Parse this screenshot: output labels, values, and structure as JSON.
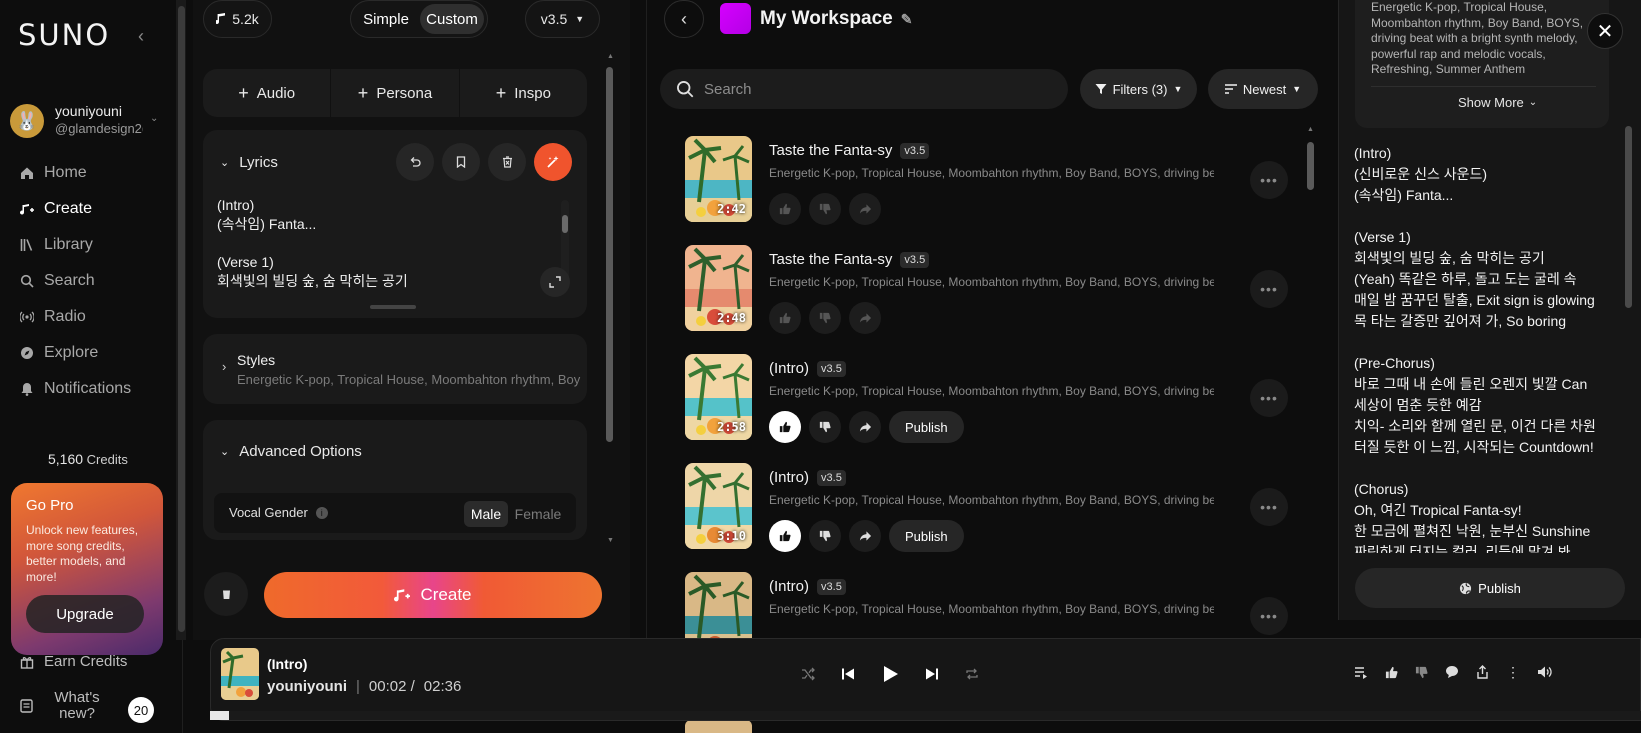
{
  "sidebar": {
    "logo": "SUNO",
    "user": {
      "name": "youniyouni",
      "handle": "@glamdesign2("
    },
    "nav": [
      {
        "label": "Home",
        "icon": "home-icon"
      },
      {
        "label": "Create",
        "icon": "create-icon"
      },
      {
        "label": "Library",
        "icon": "library-icon"
      },
      {
        "label": "Search",
        "icon": "search-icon"
      },
      {
        "label": "Radio",
        "icon": "radio-icon"
      },
      {
        "label": "Explore",
        "icon": "explore-icon"
      },
      {
        "label": "Notifications",
        "icon": "bell-icon"
      }
    ],
    "credits_value": "5,160",
    "credits_label": "Credits",
    "gopro": {
      "title": "Go Pro",
      "desc": "Unlock new features, more song credits, better models, and more!",
      "button": "Upgrade"
    },
    "earn": "Earn Credits",
    "whats_new": "What's new?",
    "whats_new_count": "20"
  },
  "create": {
    "count": "5.2k",
    "mode_simple": "Simple",
    "mode_custom": "Custom",
    "model": "v3.5",
    "add_audio": "Audio",
    "add_persona": "Persona",
    "add_inspo": "Inspo",
    "lyrics_label": "Lyrics",
    "lyrics_lines": [
      "(Intro)",
      "(속삭임) Fanta...",
      "",
      "(Verse 1)",
      "회색빛의 빌딩 숲, 숨 막히는 공기"
    ],
    "styles_label": "Styles",
    "styles_value": "Energetic K-pop, Tropical House, Moombahton rhythm, Boy ...",
    "advanced_label": "Advanced Options",
    "vocal_gender_label": "Vocal Gender",
    "vocal_male": "Male",
    "vocal_female": "Female",
    "create_button": "Create"
  },
  "workspace": {
    "title": "My Workspace",
    "search_placeholder": "Search",
    "filters": "Filters (3)",
    "sort": "Newest",
    "songs": [
      {
        "title": "Taste the Fanta-sy",
        "version": "v3.5",
        "desc": "Energetic K-pop, Tropical House, Moombahton rhythm, Boy Band, BOYS, driving beat ...",
        "duration": "2:42",
        "publish": ""
      },
      {
        "title": "Taste the Fanta-sy",
        "version": "v3.5",
        "desc": "Energetic K-pop, Tropical House, Moombahton rhythm, Boy Band, BOYS, driving beat ...",
        "duration": "2:48",
        "publish": ""
      },
      {
        "title": "(Intro)",
        "version": "v3.5",
        "desc": "Energetic K-pop, Tropical House, Moombahton rhythm, Boy Band, BOYS, driving beat ...",
        "duration": "2:58",
        "publish": "Publish"
      },
      {
        "title": "(Intro)",
        "version": "v3.5",
        "desc": "Energetic K-pop, Tropical House, Moombahton rhythm, Boy Band, BOYS, driving beat ...",
        "duration": "3:10",
        "publish": "Publish"
      },
      {
        "title": "(Intro)",
        "version": "v3.5",
        "desc": "Energetic K-pop, Tropical House, Moombahton rhythm, Boy Band, BOYS, driving beat ...",
        "duration": "",
        "publish": ""
      }
    ],
    "bottom_desc": "Energetic K-pop, Tropical House, Moombahton rhythm, Boy Band, BOYS, driving beat ..."
  },
  "detail": {
    "style_text": "Energetic K-pop, Tropical House, Moombahton rhythm, Boy Band, BOYS, driving beat with a bright synth melody, powerful rap and melodic vocals, Refreshing, Summer Anthem",
    "show_more": "Show More",
    "lyrics": "(Intro)\n(신비로운 신스 사운드)\n(속삭임) Fanta...\n\n(Verse 1)\n회색빛의 빌딩 숲, 숨 막히는 공기\n(Yeah) 똑같은 하루, 돌고 도는 굴레 속\n매일 밤 꿈꾸던 탈출, Exit sign is glowing\n목 타는 갈증만 깊어져 가, So boring\n\n(Pre-Chorus)\n바로 그때 내 손에 들린 오렌지 빛깔 Can\n세상이 멈춘 듯한 예감\n치익- 소리와 함께 열린 문, 이건 다른 차원\n터질 듯한 이 느낌, 시작되는 Countdown!\n\n(Chorus)\nOh, 여긴 Tropical Fanta-sy!\n한 모금에 펼쳐진 낙원, 눈부신 Sunshine\n짜릿하게 터지는 컬러, 리듬에 맡겨 봐",
    "publish": "Publish"
  },
  "player": {
    "title": "(Intro)",
    "artist": "youniyouni",
    "separator": "|",
    "current": "00:02 /",
    "total": "02:36",
    "progress": 0.013
  }
}
